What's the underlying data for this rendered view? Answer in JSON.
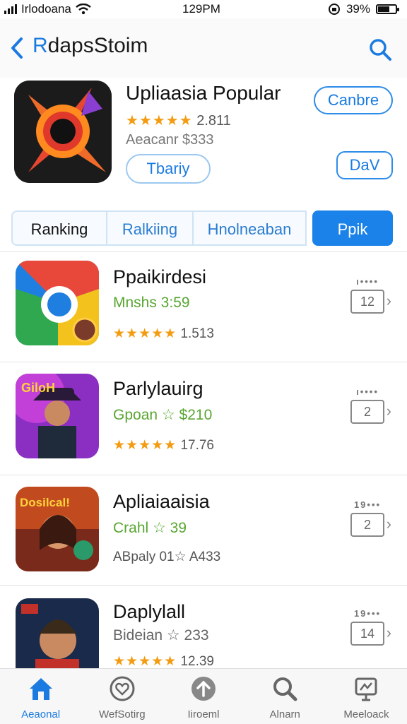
{
  "status": {
    "carrier": "Irlodoana",
    "time": "129PM",
    "battery": "39%"
  },
  "navbar": {
    "title_blue": "R",
    "title_rest": "dapsStoim"
  },
  "featured": {
    "title": "Upliaasia Popular",
    "stars": "★★★★★",
    "rating_count": "2.811",
    "price": "Aeacanr $333",
    "today_label": "Tbariy",
    "cancel_label": "Canbre",
    "day_label": "DaV"
  },
  "segments": [
    "Ranking",
    "Ralkiing",
    "Hnolneaban",
    "Ppik"
  ],
  "apps": [
    {
      "name": "Ppaikirdesi",
      "sub": "Mnshs 3:59",
      "stars": "★★★★★",
      "rating": "1.513",
      "rank_dots": "ı••••",
      "rank": "12"
    },
    {
      "name": "Parlylauirg",
      "sub": "Gpoan ☆ $210",
      "stars": "★★★★★",
      "rating": "17.76",
      "rank_dots": "ı••••",
      "rank": "2"
    },
    {
      "name": "Apliaiaaisia",
      "sub": "Crahl ☆ 39",
      "rate_text": "ABpaly 01☆ A433",
      "rank_dots": "19•••",
      "rank": "2"
    },
    {
      "name": "Daplylall",
      "sub": "Bideian ☆ 233",
      "stars": "★★★★★",
      "rating": "12.39",
      "rank_dots": "19•••",
      "rank": "14"
    }
  ],
  "tabs": [
    "Aeaonal",
    "WefSotirg",
    "Iiroeml",
    "Alnarn",
    "Meeloack"
  ],
  "colors": {
    "accent": "#1b7be0",
    "star": "#f39c12",
    "green": "#58a632"
  }
}
